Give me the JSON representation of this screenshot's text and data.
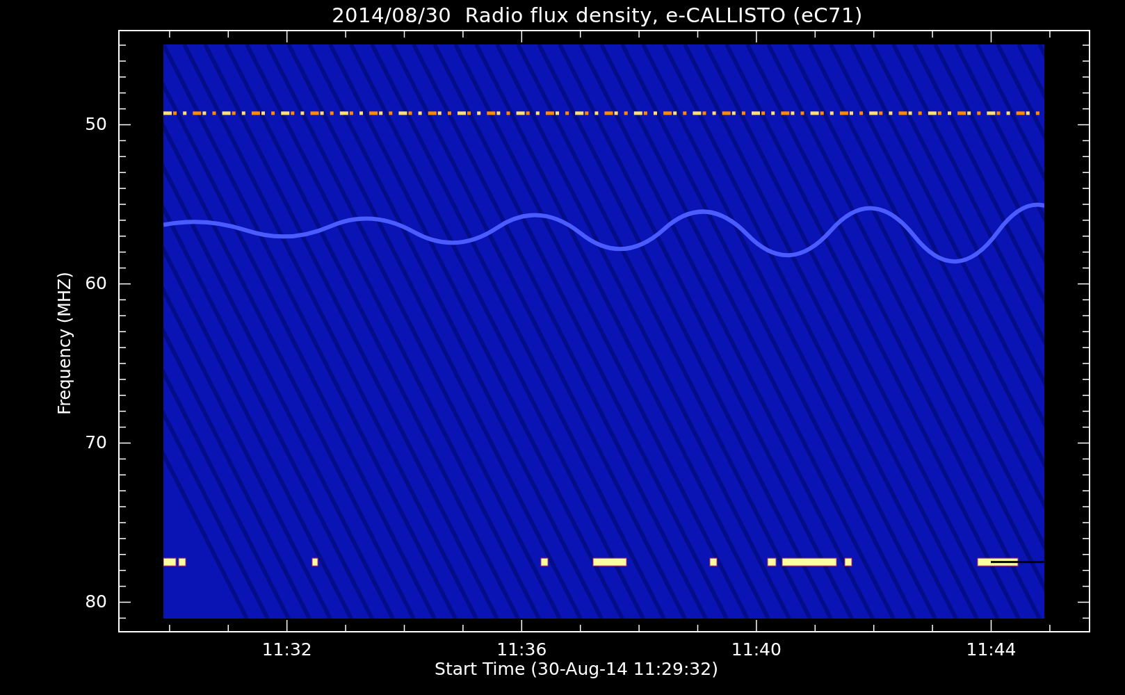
{
  "title": "2014/08/30  Radio flux density, e-CALLISTO (eC71)",
  "y_axis": {
    "label": "Frequency (MHZ)",
    "ticks": [
      "50",
      "60",
      "70",
      "80"
    ]
  },
  "x_axis": {
    "label": "Start Time (30-Aug-14 11:29:32)",
    "ticks": [
      "11:32",
      "11:36",
      "11:40",
      "11:44"
    ]
  }
}
